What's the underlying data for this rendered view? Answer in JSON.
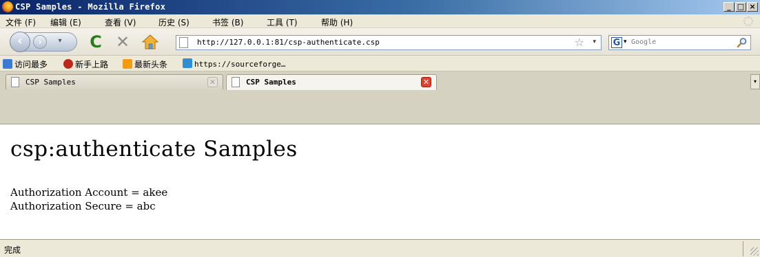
{
  "window": {
    "title": "CSP Samples - Mozilla Firefox",
    "controls": {
      "minimize": "_",
      "maximize": "□",
      "close": "×"
    }
  },
  "menu": [
    "文件 (F)",
    "编辑 (E)",
    "查看 (V)",
    "历史 (S)",
    "书签 (B)",
    "工具 (T)",
    "帮助 (H)"
  ],
  "nav": {
    "url": "http://127.0.0.1:81/csp-authenticate.csp",
    "search_placeholder": "Google",
    "icons": [
      "back-icon",
      "forward-icon",
      "reload-icon",
      "stop-icon",
      "home-icon",
      "star-icon",
      "search-icon"
    ]
  },
  "bookmarks": [
    {
      "label": "访问最多",
      "icon": "most-visited-icon",
      "color": "#3a7bd5"
    },
    {
      "label": "新手上路",
      "icon": "getting-started-icon",
      "color": "#c0271c"
    },
    {
      "label": "最新头条",
      "icon": "rss-icon",
      "color": "#f39c12"
    },
    {
      "label": "https://sourceforge…",
      "icon": "sourceforge-icon",
      "color": "#2c8fd6"
    }
  ],
  "tabs": [
    {
      "label": "CSP Samples",
      "active": false
    },
    {
      "label": "CSP Samples",
      "active": true
    }
  ],
  "page": {
    "heading": "csp:authenticate Samples",
    "lines": [
      "Authorization Account = akee",
      "Authorization Secure = abc"
    ]
  },
  "status": {
    "text": "完成"
  }
}
